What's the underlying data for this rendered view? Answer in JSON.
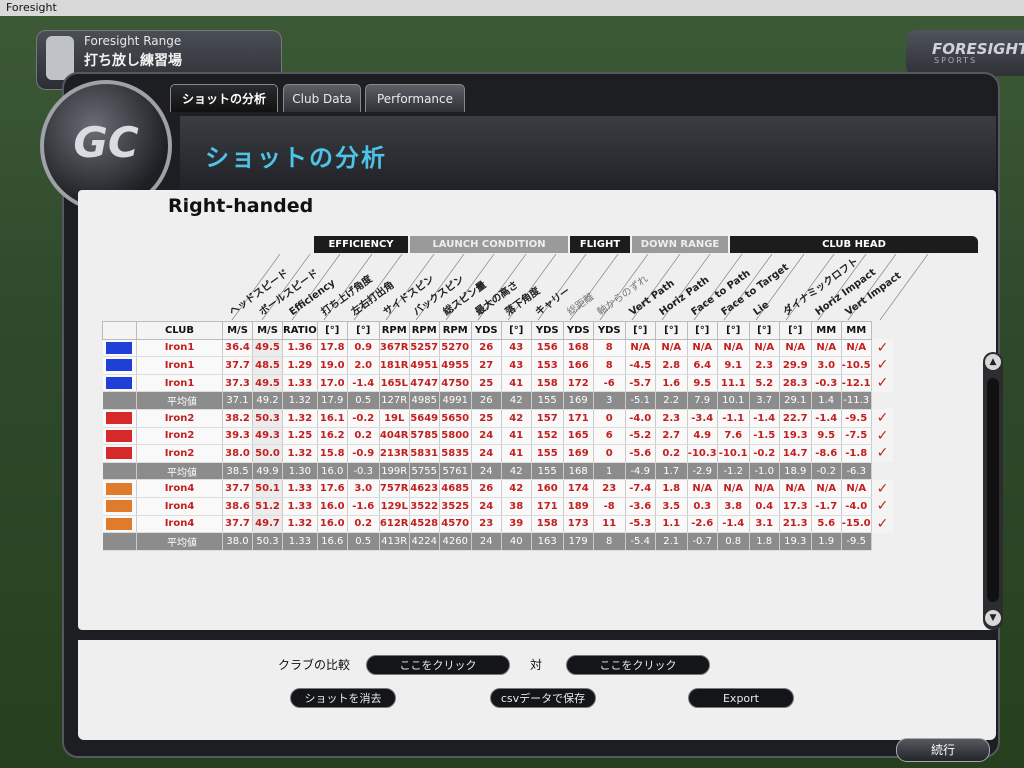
{
  "window": {
    "title": "Foresight"
  },
  "range": {
    "line1": "Foresight Range",
    "line2": "打ち放し練習場"
  },
  "brand": {
    "name": "FORESIGHT",
    "sub": "SPORTS"
  },
  "emblem": "GC",
  "tabs": [
    "ショットの分析",
    "Club Data",
    "Performance"
  ],
  "page": {
    "heading": "ショットの分析",
    "handedness": "Right-handed"
  },
  "sections": [
    "EFFICIENCY",
    "LAUNCH CONDITION",
    "FLIGHT",
    "DOWN RANGE",
    "CLUB HEAD"
  ],
  "diag_headers": [
    "ヘッドスピード",
    "ボールスピード",
    "Efficiency",
    "打ち上げ角度",
    "左右打出角",
    "サイドスピン",
    "バックスピン",
    "総スピン量",
    "最大の高さ",
    "落下角度",
    "キャリー",
    "総距離",
    "軸からのずれ",
    "Vert Path",
    "Horiz Path",
    "Face to Path",
    "Face to Target",
    "Lie",
    "ダイナミックロフト",
    "Horiz Impact",
    "Vert Impact"
  ],
  "units": [
    "CLUB",
    "M/S",
    "M/S",
    "RATIO",
    "[°]",
    "[°]",
    "RPM",
    "RPM",
    "RPM",
    "YDS",
    "[°]",
    "YDS",
    "YDS",
    "YDS",
    "[°]",
    "[°]",
    "[°]",
    "[°]",
    "[°]",
    "[°]",
    "MM",
    "MM"
  ],
  "colors": {
    "iron1": "#1f3fd6",
    "iron2": "#d62a2a",
    "iron4": "#e07b2c",
    "avg_bg": "#8c8c8c"
  },
  "rows": [
    {
      "type": "shot",
      "swatch": "iron1",
      "club": "Iron1",
      "v": [
        "36.4",
        "49.5",
        "1.36",
        "17.8",
        "0.9",
        "367R",
        "5257",
        "5270",
        "26",
        "43",
        "156",
        "168",
        "8",
        "N/A",
        "N/A",
        "N/A",
        "N/A",
        "N/A",
        "N/A",
        "N/A",
        "N/A"
      ],
      "check": "✓"
    },
    {
      "type": "shot",
      "swatch": "iron1",
      "club": "Iron1",
      "v": [
        "37.7",
        "48.5",
        "1.29",
        "19.0",
        "2.0",
        "181R",
        "4951",
        "4955",
        "27",
        "43",
        "153",
        "166",
        "8",
        "-4.5",
        "2.8",
        "6.4",
        "9.1",
        "2.3",
        "29.9",
        "3.0",
        "-10.5"
      ],
      "check": "✓"
    },
    {
      "type": "shot",
      "swatch": "iron1",
      "club": "Iron1",
      "v": [
        "37.3",
        "49.5",
        "1.33",
        "17.0",
        "-1.4",
        "165L",
        "4747",
        "4750",
        "25",
        "41",
        "158",
        "172",
        "-6",
        "-5.7",
        "1.6",
        "9.5",
        "11.1",
        "5.2",
        "28.3",
        "-0.3",
        "-12.1"
      ],
      "check": "✓"
    },
    {
      "type": "avg",
      "club": "平均値",
      "v": [
        "37.1",
        "49.2",
        "1.32",
        "17.9",
        "0.5",
        "127R",
        "4985",
        "4991",
        "26",
        "42",
        "155",
        "169",
        "3",
        "-5.1",
        "2.2",
        "7.9",
        "10.1",
        "3.7",
        "29.1",
        "1.4",
        "-11.3"
      ],
      "check": ""
    },
    {
      "type": "shot",
      "swatch": "iron2",
      "club": "Iron2",
      "v": [
        "38.2",
        "50.3",
        "1.32",
        "16.1",
        "-0.2",
        "19L",
        "5649",
        "5650",
        "25",
        "42",
        "157",
        "171",
        "0",
        "-4.0",
        "2.3",
        "-3.4",
        "-1.1",
        "-1.4",
        "22.7",
        "-1.4",
        "-9.5"
      ],
      "check": "✓"
    },
    {
      "type": "shot",
      "swatch": "iron2",
      "club": "Iron2",
      "v": [
        "39.3",
        "49.3",
        "1.25",
        "16.2",
        "0.2",
        "404R",
        "5785",
        "5800",
        "24",
        "41",
        "152",
        "165",
        "6",
        "-5.2",
        "2.7",
        "4.9",
        "7.6",
        "-1.5",
        "19.3",
        "9.5",
        "-7.5"
      ],
      "check": "✓"
    },
    {
      "type": "shot",
      "swatch": "iron2",
      "club": "Iron2",
      "v": [
        "38.0",
        "50.0",
        "1.32",
        "15.8",
        "-0.9",
        "213R",
        "5831",
        "5835",
        "24",
        "41",
        "155",
        "169",
        "0",
        "-5.6",
        "0.2",
        "-10.3",
        "-10.1",
        "-0.2",
        "14.7",
        "-8.6",
        "-1.8"
      ],
      "check": "✓"
    },
    {
      "type": "avg",
      "club": "平均値",
      "v": [
        "38.5",
        "49.9",
        "1.30",
        "16.0",
        "-0.3",
        "199R",
        "5755",
        "5761",
        "24",
        "42",
        "155",
        "168",
        "1",
        "-4.9",
        "1.7",
        "-2.9",
        "-1.2",
        "-1.0",
        "18.9",
        "-0.2",
        "-6.3"
      ],
      "check": ""
    },
    {
      "type": "shot",
      "swatch": "iron4",
      "club": "Iron4",
      "v": [
        "37.7",
        "50.1",
        "1.33",
        "17.6",
        "3.0",
        "757R",
        "4623",
        "4685",
        "26",
        "42",
        "160",
        "174",
        "23",
        "-7.4",
        "1.8",
        "N/A",
        "N/A",
        "N/A",
        "N/A",
        "N/A",
        "N/A"
      ],
      "check": "✓"
    },
    {
      "type": "shot",
      "swatch": "iron4",
      "club": "Iron4",
      "v": [
        "38.6",
        "51.2",
        "1.33",
        "16.0",
        "-1.6",
        "129L",
        "3522",
        "3525",
        "24",
        "38",
        "171",
        "189",
        "-8",
        "-3.6",
        "3.5",
        "0.3",
        "3.8",
        "0.4",
        "17.3",
        "-1.7",
        "-4.0"
      ],
      "check": "✓"
    },
    {
      "type": "shot",
      "swatch": "iron4",
      "club": "Iron4",
      "v": [
        "37.7",
        "49.7",
        "1.32",
        "16.0",
        "0.2",
        "612R",
        "4528",
        "4570",
        "23",
        "39",
        "158",
        "173",
        "11",
        "-5.3",
        "1.1",
        "-2.6",
        "-1.4",
        "3.1",
        "21.3",
        "5.6",
        "-15.0"
      ],
      "check": "✓"
    },
    {
      "type": "avg",
      "club": "平均値",
      "v": [
        "38.0",
        "50.3",
        "1.33",
        "16.6",
        "0.5",
        "413R",
        "4224",
        "4260",
        "24",
        "40",
        "163",
        "179",
        "8",
        "-5.4",
        "2.1",
        "-0.7",
        "0.8",
        "1.8",
        "19.3",
        "1.9",
        "-9.5"
      ],
      "check": ""
    }
  ],
  "bottom": {
    "compare_label": "クラブの比較",
    "click1": "ここをクリック",
    "vs": "対",
    "click2": "ここをクリック",
    "clear": "ショットを消去",
    "csv": "csvデータで保存",
    "export": "Export",
    "continue": "続行"
  },
  "scroll": {
    "up": "▲",
    "down": "▼"
  }
}
